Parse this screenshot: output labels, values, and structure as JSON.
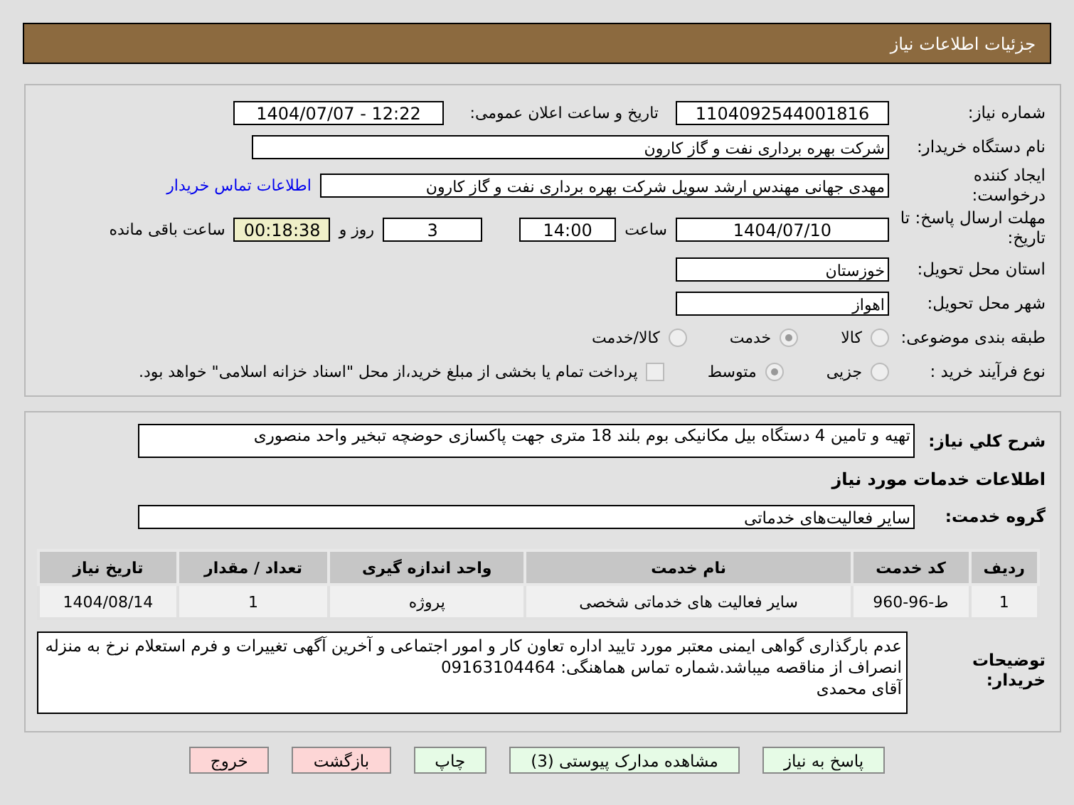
{
  "header": {
    "title": "جزئیات اطلاعات نیاز"
  },
  "need_number": {
    "label": "شماره نیاز:",
    "value": "1104092544001816"
  },
  "announce": {
    "label": "تاریخ و ساعت اعلان عمومی:",
    "value": "1404/07/07 - 12:22"
  },
  "buyer": {
    "label": "نام دستگاه خریدار:",
    "value": "شرکت بهره برداری نفت و گاز کارون"
  },
  "creator": {
    "label": "ایجاد کننده درخواست:",
    "value": "مهدی جهانی مهندس ارشد سویل شرکت بهره برداری نفت و گاز کارون",
    "link": "اطلاعات تماس خریدار"
  },
  "deadline": {
    "label": "مهلت ارسال پاسخ: تا تاریخ:",
    "date": "1404/07/10",
    "time_label": "ساعت",
    "time": "14:00",
    "days": "3",
    "days_label": "روز و",
    "remaining": "00:18:38",
    "remaining_label": "ساعت باقی مانده"
  },
  "province": {
    "label": "استان محل تحویل:",
    "value": "خوزستان"
  },
  "city": {
    "label": "شهر محل تحویل:",
    "value": "اهواز"
  },
  "category": {
    "label": "طبقه بندی موضوعی:",
    "options": [
      {
        "label": "کالا",
        "selected": false
      },
      {
        "label": "خدمت",
        "selected": true
      },
      {
        "label": "کالا/خدمت",
        "selected": false
      }
    ]
  },
  "process": {
    "label": "نوع فرآیند خرید :",
    "options": [
      {
        "label": "جزیی",
        "selected": false
      },
      {
        "label": "متوسط",
        "selected": true
      }
    ],
    "treasury": {
      "label": "پرداخت تمام یا بخشی از مبلغ خرید،از محل \"اسناد خزانه اسلامی\" خواهد بود.",
      "checked": false
    }
  },
  "description": {
    "label": "شرح کلي نياز:",
    "value": "تهیه و تامین 4 دستگاه بیل مکانیکی بوم بلند 18 متری جهت پاکسازی حوضچه تبخیر واحد منصوری"
  },
  "services_title": "اطلاعات خدمات مورد نیاز",
  "service_group": {
    "label": "گروه خدمت:",
    "value": "سایر فعالیت‌های خدماتی"
  },
  "table": {
    "columns": [
      "ردیف",
      "کد خدمت",
      "نام خدمت",
      "واحد اندازه گیری",
      "تعداد / مقدار",
      "تاریخ نیاز"
    ],
    "rows": [
      [
        "1",
        "ط-96-960",
        "سایر فعالیت های خدماتی شخصی",
        "پروژه",
        "1",
        "1404/08/14"
      ]
    ]
  },
  "notes": {
    "label": "توضیحات خریدار:",
    "value": "عدم بارگذاری گواهی ایمنی معتبر مورد تایید اداره تعاون کار و امور اجتماعی و آخرین آگهی تغییرات و فرم استعلام نرخ به منزله انصراف از مناقصه میباشد.شماره تماس هماهنگی: 09163104464\nآقای محمدی"
  },
  "buttons": [
    {
      "label": "پاسخ به نیاز",
      "kind": "green"
    },
    {
      "label": "مشاهده مدارک پیوستی (3)",
      "kind": "green"
    },
    {
      "label": "چاپ",
      "kind": "green"
    },
    {
      "label": "بازگشت",
      "kind": "red"
    },
    {
      "label": "خروج",
      "kind": "red"
    }
  ]
}
